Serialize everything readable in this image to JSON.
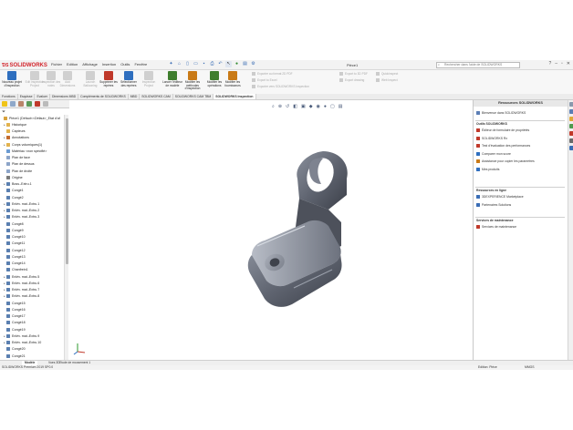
{
  "title_bar": {
    "logo": "SOLIDWORKS",
    "menus": [
      "Fichier",
      "Edition",
      "Affichage",
      "Insertion",
      "Outils",
      "Fenêtre"
    ],
    "document_title": "Pièce1",
    "help_search_placeholder": "Rechercher dans l'aide de SOLIDWORKS"
  },
  "ribbon": {
    "buttons": [
      {
        "label": "Nouveau projet d'inspection",
        "enabled": true,
        "color": "#2f6fbf"
      },
      {
        "label": "Edit inspection Project",
        "enabled": false,
        "color": "#888888"
      },
      {
        "label": "Inspection des notes",
        "enabled": false,
        "color": "#888888"
      },
      {
        "label": "Add Dimensions",
        "enabled": false,
        "color": "#888888"
      },
      {
        "label": "Launch Ballooning",
        "enabled": false,
        "color": "#888888"
      },
      {
        "label": "Supprimer les repères",
        "enabled": true,
        "color": "#c0392b"
      },
      {
        "label": "Sélectionner des repères",
        "enabled": true,
        "color": "#2f6fbf"
      },
      {
        "label": "Inspection Project",
        "enabled": false,
        "color": "#888888"
      },
      {
        "label": "Lancer l'éditeur de modèle",
        "enabled": true,
        "color": "#3f7e2e"
      },
      {
        "label": "Modifier les méthodes d'inspection",
        "enabled": true,
        "color": "#c97a17"
      },
      {
        "label": "Modifier les opérations",
        "enabled": true,
        "color": "#3f7e2e"
      },
      {
        "label": "Modifier les fournisseurs",
        "enabled": true,
        "color": "#c97a17"
      }
    ],
    "small_items": [
      "Exporter au format 2D PDF",
      "Export to Excel",
      "Exporter vers SOLIDWORKS Inspection",
      "Export to 3D PDF",
      "Export drawing",
      "Quickinspect",
      "Web Inspect"
    ]
  },
  "cmd_tabs": [
    {
      "label": "Fonctions",
      "active": false
    },
    {
      "label": "Esquisse",
      "active": false
    },
    {
      "label": "Evaluer",
      "active": false
    },
    {
      "label": "Dimensions MBD",
      "active": false
    },
    {
      "label": "Compléments de SOLIDWORKS",
      "active": false
    },
    {
      "label": "MBD",
      "active": false
    },
    {
      "label": "SOLIDWORKS CAM",
      "active": false
    },
    {
      "label": "SOLIDWORKS CAM TBM",
      "active": false
    },
    {
      "label": "SOLIDWORKS Inspection",
      "active": true
    }
  ],
  "tree": [
    {
      "label": "Pièce1 (Défaut<<Défaut>_Etat d'af",
      "icon": "part",
      "expander": "",
      "indent": 0
    },
    {
      "label": "Historique",
      "icon": "folder",
      "expander": "▸",
      "indent": 1
    },
    {
      "label": "Capteurs",
      "icon": "folder",
      "expander": "",
      "indent": 1
    },
    {
      "label": "Annotations",
      "icon": "annotation",
      "expander": "▸",
      "indent": 1
    },
    {
      "label": "Corps volumiques(1)",
      "icon": "folder",
      "expander": "▸",
      "indent": 1
    },
    {
      "label": "Matériau <non spécifié>",
      "icon": "material",
      "expander": "",
      "indent": 1
    },
    {
      "label": "Plan de face",
      "icon": "plane",
      "expander": "",
      "indent": 1
    },
    {
      "label": "Plan de dessus",
      "icon": "plane",
      "expander": "",
      "indent": 1
    },
    {
      "label": "Plan de droite",
      "icon": "plane",
      "expander": "",
      "indent": 1
    },
    {
      "label": "Origine",
      "icon": "origin",
      "expander": "",
      "indent": 1
    },
    {
      "label": "Boss.-Extru.1",
      "icon": "feature",
      "expander": "▸",
      "indent": 1
    },
    {
      "label": "Congé1",
      "icon": "feature",
      "expander": "",
      "indent": 1
    },
    {
      "label": "Congé2",
      "icon": "feature",
      "expander": "",
      "indent": 1
    },
    {
      "label": "Enlèv. mat.-Extru.1",
      "icon": "feature",
      "expander": "▸",
      "indent": 1
    },
    {
      "label": "Enlèv. mat.-Extru.2",
      "icon": "feature",
      "expander": "▸",
      "indent": 1
    },
    {
      "label": "Enlèv. mat.-Extru.3",
      "icon": "feature",
      "expander": "▸",
      "indent": 1
    },
    {
      "label": "Congé8",
      "icon": "feature",
      "expander": "",
      "indent": 1
    },
    {
      "label": "Congé9",
      "icon": "feature",
      "expander": "",
      "indent": 1
    },
    {
      "label": "Congé10",
      "icon": "feature",
      "expander": "",
      "indent": 1
    },
    {
      "label": "Congé11",
      "icon": "feature",
      "expander": "",
      "indent": 1
    },
    {
      "label": "Congé12",
      "icon": "feature",
      "expander": "",
      "indent": 1
    },
    {
      "label": "Congé13",
      "icon": "feature",
      "expander": "",
      "indent": 1
    },
    {
      "label": "Congé14",
      "icon": "feature",
      "expander": "",
      "indent": 1
    },
    {
      "label": "Chanfrein1",
      "icon": "feature",
      "expander": "",
      "indent": 1
    },
    {
      "label": "Enlèv. mat.-Extru.5",
      "icon": "feature",
      "expander": "▸",
      "indent": 1
    },
    {
      "label": "Enlèv. mat.-Extru.6",
      "icon": "feature",
      "expander": "▸",
      "indent": 1
    },
    {
      "label": "Enlèv. mat.-Extru.7",
      "icon": "feature",
      "expander": "▸",
      "indent": 1
    },
    {
      "label": "Enlèv. mat.-Extru.8",
      "icon": "feature",
      "expander": "▸",
      "indent": 1
    },
    {
      "label": "Congé15",
      "icon": "feature",
      "expander": "",
      "indent": 1
    },
    {
      "label": "Congé16",
      "icon": "feature",
      "expander": "",
      "indent": 1
    },
    {
      "label": "Congé17",
      "icon": "feature",
      "expander": "",
      "indent": 1
    },
    {
      "label": "Congé18",
      "icon": "feature",
      "expander": "",
      "indent": 1
    },
    {
      "label": "Congé19",
      "icon": "feature",
      "expander": "",
      "indent": 1
    },
    {
      "label": "Enlèv. mat.-Extru.9",
      "icon": "feature",
      "expander": "▸",
      "indent": 1
    },
    {
      "label": "Enlèv. mat.-Extru.10",
      "icon": "feature",
      "expander": "▸",
      "indent": 1
    },
    {
      "label": "Congé20",
      "icon": "feature",
      "expander": "",
      "indent": 1
    },
    {
      "label": "Congé21",
      "icon": "feature",
      "expander": "",
      "indent": 1
    }
  ],
  "bottom_tabs": [
    {
      "label": "Modèle",
      "active": true
    },
    {
      "label": "Vues 3D",
      "active": false
    },
    {
      "label": "Etude de mouvement 1",
      "active": false
    }
  ],
  "status_bar": {
    "left": "SOLIDWORKS Premium 2019 SP0.0",
    "mode": "Edition: Pièce",
    "units": "MMGS"
  },
  "resources": {
    "title": "Ressources SOLIDWORKS",
    "welcome": "Bienvenue dans SOLIDWORKS",
    "sections": [
      {
        "title": "Outils SOLIDWORKS",
        "items": [
          "Éditeur de formulaire de propriétés",
          "SOLIDWORKS Rx",
          "Test d'évaluation des performances",
          "Comparer mon score",
          "Assistance pour copier les paramètres",
          "Mes produits"
        ]
      },
      {
        "title": "Ressources en ligne",
        "items": [
          "3DEXPERIENCE Marketplace",
          "Partenaires Solutions"
        ]
      },
      {
        "title": "Services de maintenance",
        "items": [
          "Services de maintenance"
        ]
      }
    ]
  },
  "colors": {
    "brand": "#d2232a",
    "model_body": "#5f6470",
    "model_light": "#a7adb8",
    "feature_icon": "#5a7fb0"
  }
}
